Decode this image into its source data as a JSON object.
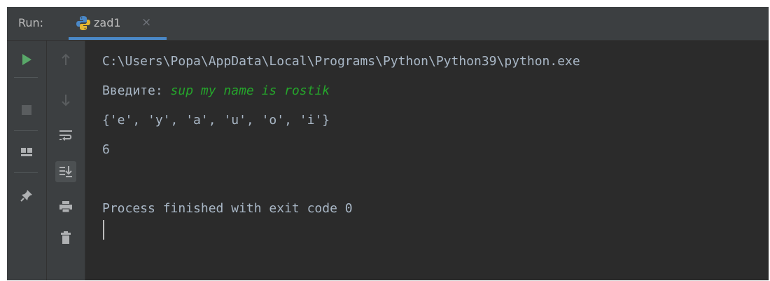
{
  "run_panel": {
    "label": "Run:",
    "tab": {
      "title": "zad1",
      "icon": "python-icon",
      "close_symbol": "×"
    }
  },
  "toolbar_left": {
    "buttons": [
      {
        "icon": "run-icon",
        "color": "#59a869"
      },
      {
        "icon": "stop-icon",
        "color": "#5a5d5f"
      },
      {
        "icon": "layout-icon",
        "color": "#afb1b3"
      },
      {
        "icon": "pin-icon",
        "color": "#afb1b3"
      }
    ]
  },
  "toolbar_mid": {
    "buttons": [
      {
        "icon": "arrow-up-icon",
        "color": "#5a5d5f"
      },
      {
        "icon": "arrow-down-icon",
        "color": "#5a5d5f"
      },
      {
        "icon": "soft-wrap-icon",
        "color": "#afb1b3"
      },
      {
        "icon": "scroll-to-end-icon",
        "color": "#afb1b3",
        "active": true
      },
      {
        "icon": "print-icon",
        "color": "#afb1b3"
      },
      {
        "icon": "trash-icon",
        "color": "#afb1b3"
      }
    ]
  },
  "console": {
    "command_line": "C:\\Users\\Popa\\AppData\\Local\\Programs\\Python\\Python39\\python.exe",
    "prompt": "Введите: ",
    "user_input": "sup my name is rostik",
    "output_set": "{'e', 'y', 'a', 'u', 'o', 'i'}",
    "output_count": "6",
    "exit_message": "Process finished with exit code 0"
  },
  "colors": {
    "background": "#2b2b2b",
    "toolbar": "#3c3f41",
    "console_text": "#a9b7c6",
    "user_input_text": "#25a52b",
    "tab_underline": "#4a88c7"
  }
}
